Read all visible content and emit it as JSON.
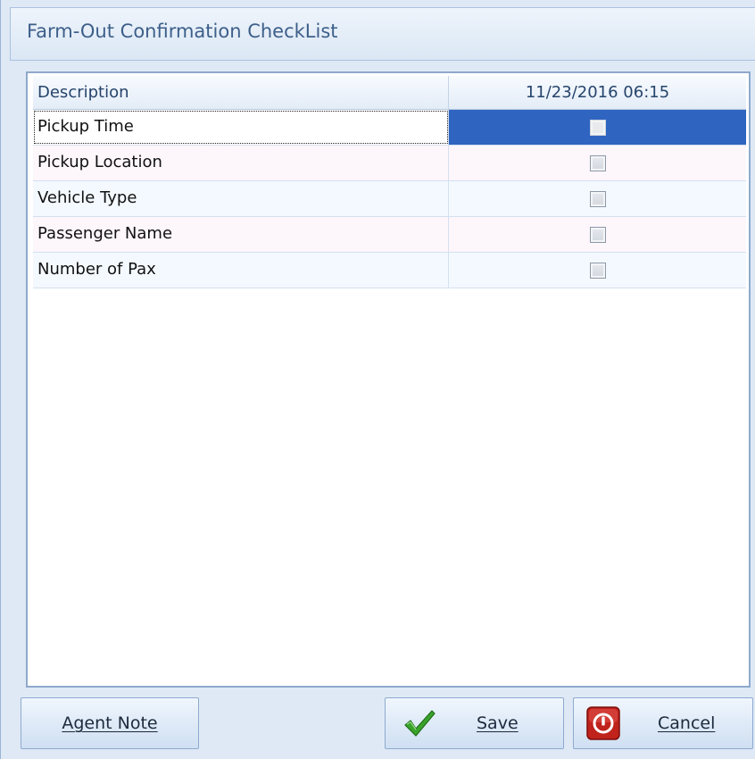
{
  "window": {
    "title": "Farm-Out Confirmation CheckList"
  },
  "grid": {
    "columns": [
      "Description",
      "11/23/2016 06:15"
    ],
    "rows": [
      {
        "description": "Pickup Time",
        "checked": false,
        "focused": true
      },
      {
        "description": "Pickup Location",
        "checked": false
      },
      {
        "description": "Vehicle Type",
        "checked": false
      },
      {
        "description": "Passenger Name",
        "checked": false
      },
      {
        "description": "Number of Pax",
        "checked": false
      }
    ],
    "selection_color": "#2f64c1"
  },
  "buttons": {
    "agent_note": "Agent Note",
    "save": "Save",
    "cancel": "Cancel"
  },
  "icons": {
    "save": "green-checkmark-icon",
    "cancel": "red-power-icon"
  }
}
